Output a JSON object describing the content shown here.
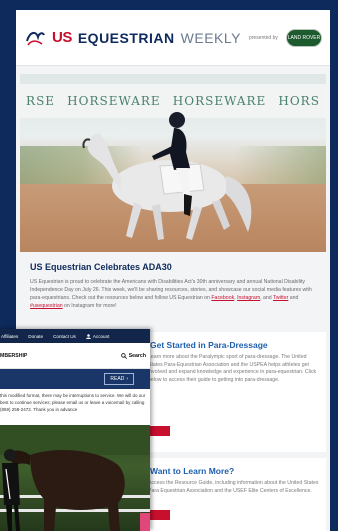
{
  "newsletter": {
    "brand": {
      "us": "US",
      "equestrian": "EQUESTRIAN",
      "weekly": "WEEKLY",
      "presented_by": "presented by",
      "sponsor": "LAND ROVER"
    },
    "hero": {
      "banner_texts": [
        "RSE",
        "HORSEWARE",
        "HORSEWARE",
        "HORS"
      ]
    },
    "article": {
      "title": "US Equestrian Celebrates ADA30",
      "body": "US Equestrian is proud to celebrate the Americans with Disabilities Act's 30th anniversary and annual National Disability Independence Day on July 26. This week, we'll be sharing resources, stories, and showcase our social media features with para-equestrians. Check out the resources below and follow US Equestrian on",
      "link_facebook": "Facebook",
      "connector": ", ",
      "link_instagram": "Instagram",
      "and_text": ", and ",
      "link_twitter": "Twitter",
      "tail": " and ",
      "link_hashtag": "#usequestrian",
      "end": " on Instagram for more!"
    },
    "cards": [
      {
        "title": "Get Started in Para-Dressage",
        "text": "Learn more about the Paralympic sport of para-dressage. The United States Para-Equestrian Association and the USPEA helps athletes get involved and expand knowledge and experience in para-equestrian. Click below to access their guide to getting into para-dressage."
      },
      {
        "title": "Want to Learn More?",
        "text": "Access the Resource Guide, including information about the United States Para Equestrian Association and the USEF Elite Centers of Excellence."
      }
    ]
  },
  "site": {
    "nav": {
      "affiliates": "Affiliates",
      "donate": "Donate",
      "contact": "Contact Us",
      "account": "Account"
    },
    "brand": "MBERSHIP",
    "search_label": "Search",
    "read_label": "READ",
    "notice": "this modified format, there may be interruptions to service. We will do our best to continue services; please email us or leave a voicemail by calling (859) 258-2472. Thank you in advance"
  },
  "colors": {
    "navy": "#0e2a5c",
    "brand_red": "#c8102e",
    "link_blue": "#1f5fb0"
  }
}
